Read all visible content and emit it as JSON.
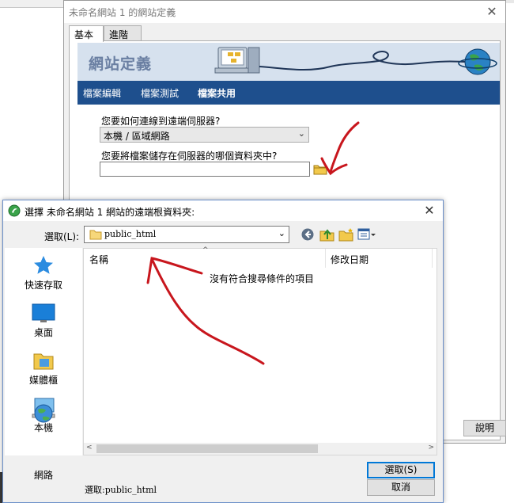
{
  "site_window": {
    "title": "未命名網站 1 的網站定義",
    "close": "✕",
    "tabs": [
      {
        "label": "基本"
      },
      {
        "label": "進階"
      }
    ],
    "banner_title": "網站定義",
    "nav": [
      {
        "label": "檔案編輯"
      },
      {
        "label": "檔案測試"
      },
      {
        "label": "檔案共用"
      }
    ],
    "connect_question": "您要如何連線到遠端伺服器?",
    "connect_value": "本機 / 區域網路",
    "folder_question": "您要將檔案儲存在伺服器的哪個資料夾中?",
    "folder_value": "",
    "help_button": "說明"
  },
  "dialog": {
    "title": "選擇 未命名網站 1 網站的遠端根資料夾:",
    "close": "✕",
    "look_in_label": "選取(L):",
    "look_in_value": "public_html",
    "places": [
      {
        "label": "快速存取",
        "icon": "star-icon"
      },
      {
        "label": "桌面",
        "icon": "desktop-icon"
      },
      {
        "label": "媒體櫃",
        "icon": "library-icon"
      },
      {
        "label": "本機",
        "icon": "computer-icon"
      },
      {
        "label": "網路",
        "icon": "network-icon"
      }
    ],
    "columns": {
      "name": "名稱",
      "date": "修改日期"
    },
    "empty_message": "沒有符合搜尋條件的項目",
    "status": "選取:public_html",
    "ok_button": "選取(S)",
    "cancel_button": "取消"
  },
  "colors": {
    "nav_bar": "#1e4f8d",
    "banner": "#d6e1ee",
    "annotation": "#c8161d"
  }
}
